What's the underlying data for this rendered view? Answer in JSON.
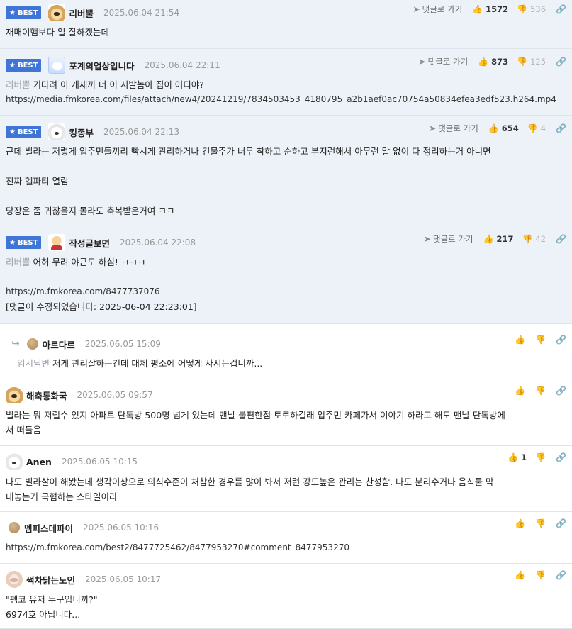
{
  "best_label": "BEST",
  "goto_label": "댓글로 가기",
  "comments": [
    {
      "nick": "리버뿔",
      "date": "2025.06.04 21:54",
      "up": "1572",
      "down": "536",
      "lines": [
        {
          "text": "재매이햄보다 일 잘하겠는데"
        }
      ]
    },
    {
      "nick": "포계의업상입니다",
      "date": "2025.06.04 22:11",
      "up": "873",
      "down": "125",
      "lines": [
        {
          "mention": "리버뿔",
          "text": " 기다려 이 개새끼 너 이 시발놈아 집이 어디야?"
        },
        {
          "text": "https://media.fmkorea.com/files/attach/new4/20241219/7834503453_4180795_a2b1aef0ac70754a50834efea3edf523.h264.mp4"
        }
      ]
    },
    {
      "nick": "킹종부",
      "date": "2025.06.04 22:13",
      "up": "654",
      "down": "4",
      "lines": [
        {
          "text": "근데 빌라는 저렇게 입주민들끼리 빡시게 관리하거나 건물주가 너무 착하고 순하고 부지런해서 아무런 말 없이 다 정리하는거 아니면"
        },
        {
          "text": ""
        },
        {
          "text": "진짜 헬파티 열림"
        },
        {
          "text": ""
        },
        {
          "text": "당장은 좀 귀찮을지 몰라도 축복받은거여 ㅋㅋ"
        }
      ]
    },
    {
      "nick": "작성글보면",
      "date": "2025.06.04 22:08",
      "up": "217",
      "down": "42",
      "lines": [
        {
          "mention": "리버뿔",
          "text": " 어허 무려 야근도 하심! ㅋㅋㅋ"
        },
        {
          "text": ""
        },
        {
          "text": "https://m.fmkorea.com/8477737076"
        },
        {
          "text": "[댓글이 수정되었습니다: 2025-06-04 22:23:01]"
        }
      ]
    },
    {
      "nick": "아르다르",
      "date": "2025.06.05 15:09",
      "lines": [
        {
          "mention": "임시닉변",
          "text": " 저게 관리잘하는건데 대체 평소에 어떻게 사시는겁니까..."
        }
      ]
    },
    {
      "nick": "해축통화국",
      "date": "2025.06.05 09:57",
      "lines": [
        {
          "text": "빌라는 뭐 저럴수 있지 아파트 단톡방 500명 넘게 있는데 맨날 불편한점 토로하길래 입주민 카페가서 이야기 하라고 해도 맨날 단톡방에"
        },
        {
          "text": "서 떠들음"
        }
      ]
    },
    {
      "nick": "Anen",
      "date": "2025.06.05 10:15",
      "up": "1",
      "lines": [
        {
          "text": "나도 빌라살이 해봤는데 생각이상으로 의식수준이 처참한 경우를 많이 봐서 저런 강도높은 관리는 찬성함. 나도 분리수거나 음식물 막"
        },
        {
          "text": "내놓는거 극혐하는 스타일이라"
        }
      ]
    },
    {
      "nick": "멤피스데파이",
      "date": "2025.06.05 10:16",
      "lines": [
        {
          "text": "https://m.fmkorea.com/best2/8477725462/8477953270#comment_8477953270"
        }
      ]
    },
    {
      "nick": "썩차닭는노인",
      "date": "2025.06.05 10:17",
      "lines": [
        {
          "text": "\"펨코 유저 누구입니까?\""
        },
        {
          "text": "6974호 아닙니다..."
        }
      ]
    }
  ]
}
